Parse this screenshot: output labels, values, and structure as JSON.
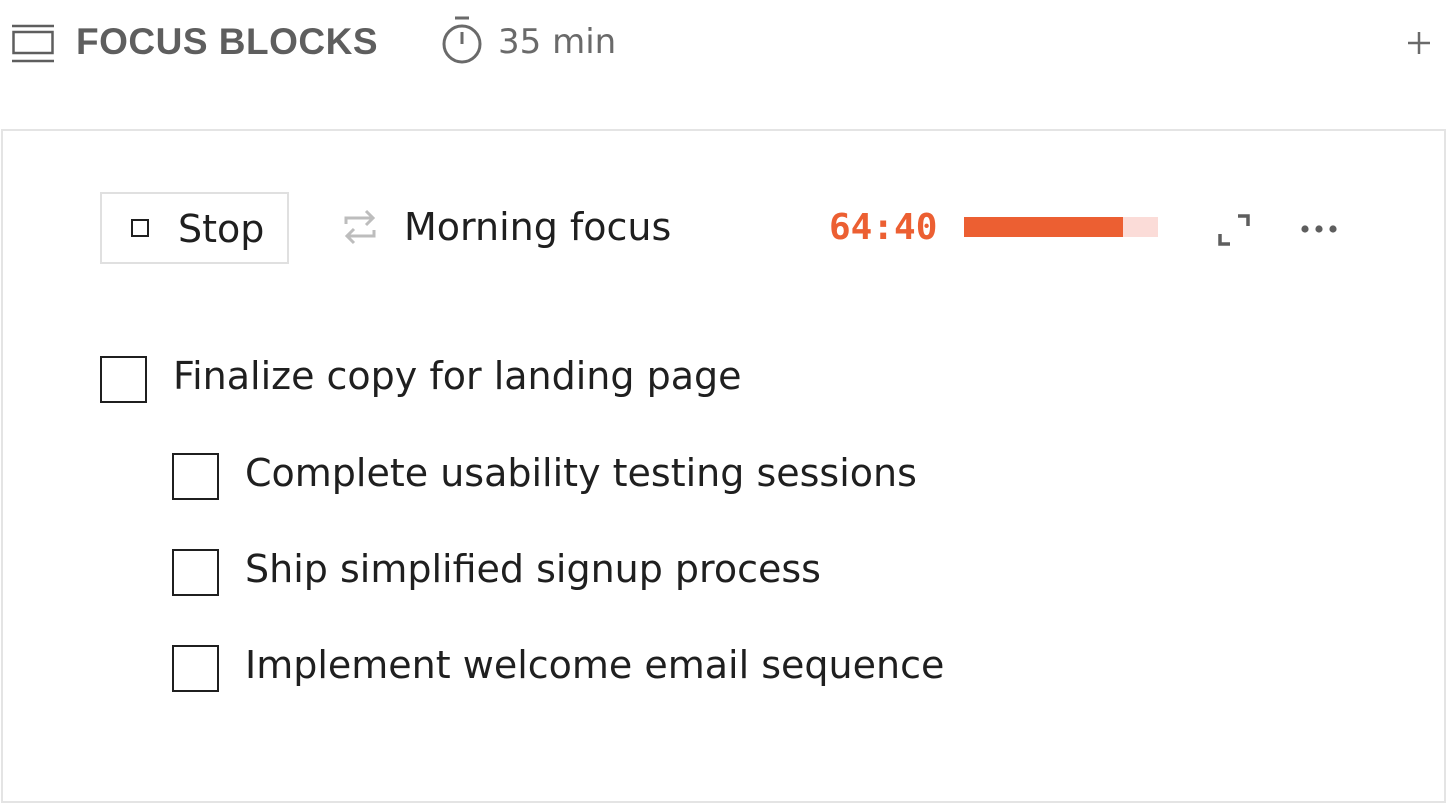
{
  "header": {
    "title": "FOCUS BLOCKS",
    "duration": "35 min",
    "icons": {
      "section": "blocks-icon",
      "duration": "timer-icon",
      "add": "plus-icon"
    }
  },
  "session": {
    "stop_label": "Stop",
    "name": "Morning focus",
    "remaining": "64:40",
    "progress_percent": 82,
    "icons": {
      "stop": "stop-icon",
      "repeat": "repeat-icon",
      "expand": "expand-icon",
      "more": "more-icon"
    }
  },
  "tasks": [
    {
      "label": "Finalize copy for landing page",
      "level": 0,
      "checked": false
    },
    {
      "label": "Complete usability testing sessions",
      "level": 1,
      "checked": false
    },
    {
      "label": "Ship simplified signup process",
      "level": 1,
      "checked": false
    },
    {
      "label": "Implement welcome email sequence",
      "level": 1,
      "checked": false
    }
  ],
  "colors": {
    "accent": "#ec5f32",
    "progress_track": "#fbdcd8",
    "muted_text": "#5e5e5e"
  }
}
